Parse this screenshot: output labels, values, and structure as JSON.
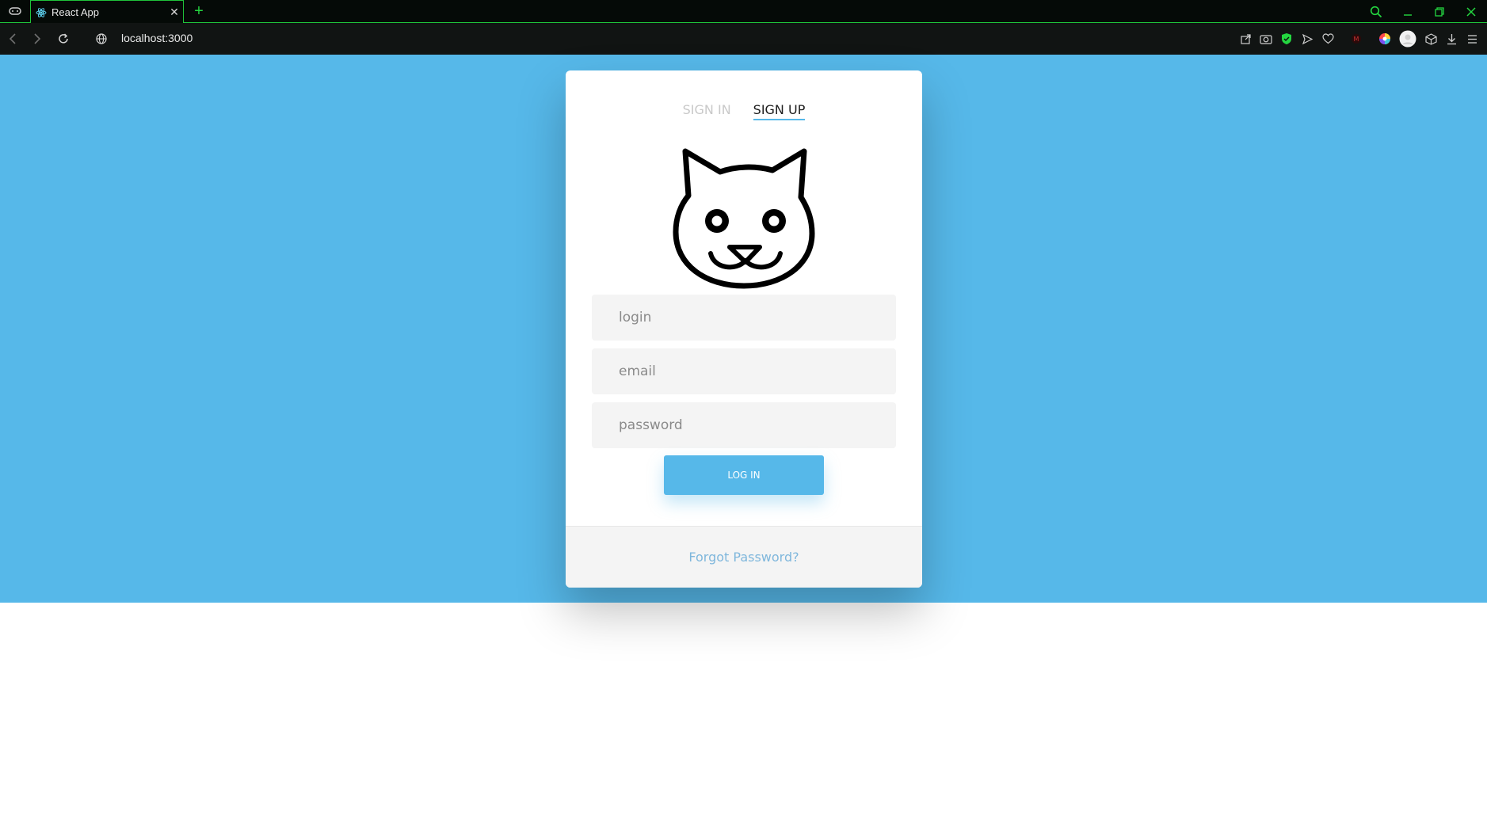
{
  "browser": {
    "tab_title": "React App",
    "url": "localhost:3000",
    "accent_color": "#24d640",
    "icons": {
      "workspace": "gamepad-icon",
      "tab_favicon": "react-icon",
      "tab_close": "close-icon",
      "new_tab": "plus-icon",
      "search": "search-icon",
      "minimize": "minimize-icon",
      "restore": "restore-icon",
      "close_window": "close-window-icon",
      "back": "back-arrow-icon",
      "forward": "forward-arrow-icon",
      "reload": "reload-icon",
      "site_info": "globe-icon"
    },
    "toolbar_icons": [
      "share-icon",
      "camera-icon",
      "shield-icon",
      "send-icon",
      "heart-icon",
      "extension-icon",
      "color-wheel-icon",
      "avatar-icon",
      "cube-icon",
      "download-icon",
      "menu-icon"
    ]
  },
  "page": {
    "background_color": "#56b8e9",
    "auth_tabs": [
      {
        "label": "SIGN IN",
        "active": false
      },
      {
        "label": "SIGN UP",
        "active": true
      }
    ],
    "logo": "cat-face-icon",
    "fields": {
      "login_placeholder": "login",
      "email_placeholder": "email",
      "password_placeholder": "password"
    },
    "submit_label": "LOG IN",
    "forgot_label": "Forgot Password?"
  }
}
